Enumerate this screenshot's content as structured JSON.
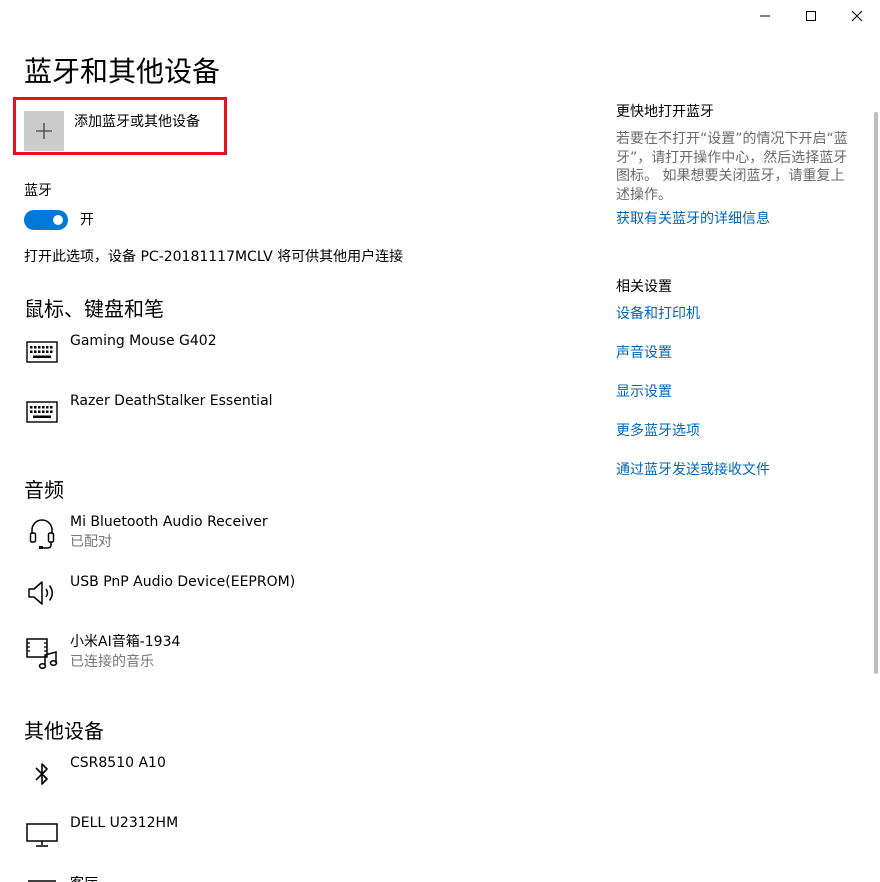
{
  "page": {
    "title": "蓝牙和其他设备"
  },
  "add_device": {
    "label": "添加蓝牙或其他设备"
  },
  "bluetooth": {
    "label": "蓝牙",
    "state_label": "开",
    "on": true,
    "description": "打开此选项，设备 PC-20181117MCLV 将可供其他用户连接"
  },
  "sections": {
    "mouse": {
      "title": "鼠标、键盘和笔",
      "devices": [
        {
          "name": "Gaming Mouse G402",
          "status": "",
          "icon": "keyboard-icon"
        },
        {
          "name": "Razer DeathStalker Essential",
          "status": "",
          "icon": "keyboard-icon"
        }
      ]
    },
    "audio": {
      "title": "音频",
      "devices": [
        {
          "name": "Mi Bluetooth Audio Receiver",
          "status": "已配对",
          "icon": "headset-icon"
        },
        {
          "name": "USB PnP Audio Device(EEPROM)",
          "status": "",
          "icon": "speaker-icon"
        },
        {
          "name": "小米AI音箱-1934",
          "status": "已连接的音乐",
          "icon": "music-device-icon"
        }
      ]
    },
    "other": {
      "title": "其他设备",
      "devices": [
        {
          "name": "CSR8510 A10",
          "status": "",
          "icon": "bluetooth-icon"
        },
        {
          "name": "DELL U2312HM",
          "status": "",
          "icon": "monitor-icon"
        },
        {
          "name": "客厅",
          "status": "",
          "icon": "device-icon"
        }
      ]
    }
  },
  "sidebar": {
    "quick": {
      "title": "更快地打开蓝牙",
      "description": "若要在不打开“设置”的情况下开启“蓝牙”，请打开操作中心，然后选择蓝牙图标。 如果想要关闭蓝牙，请重复上述操作。",
      "link": "获取有关蓝牙的详细信息"
    },
    "related": {
      "title": "相关设置",
      "links": [
        "设备和打印机",
        "声音设置",
        "显示设置",
        "更多蓝牙选项",
        "通过蓝牙发送或接收文件"
      ]
    }
  },
  "colors": {
    "accent": "#0078d7",
    "link": "#0067b8",
    "highlight": "#e81123"
  }
}
